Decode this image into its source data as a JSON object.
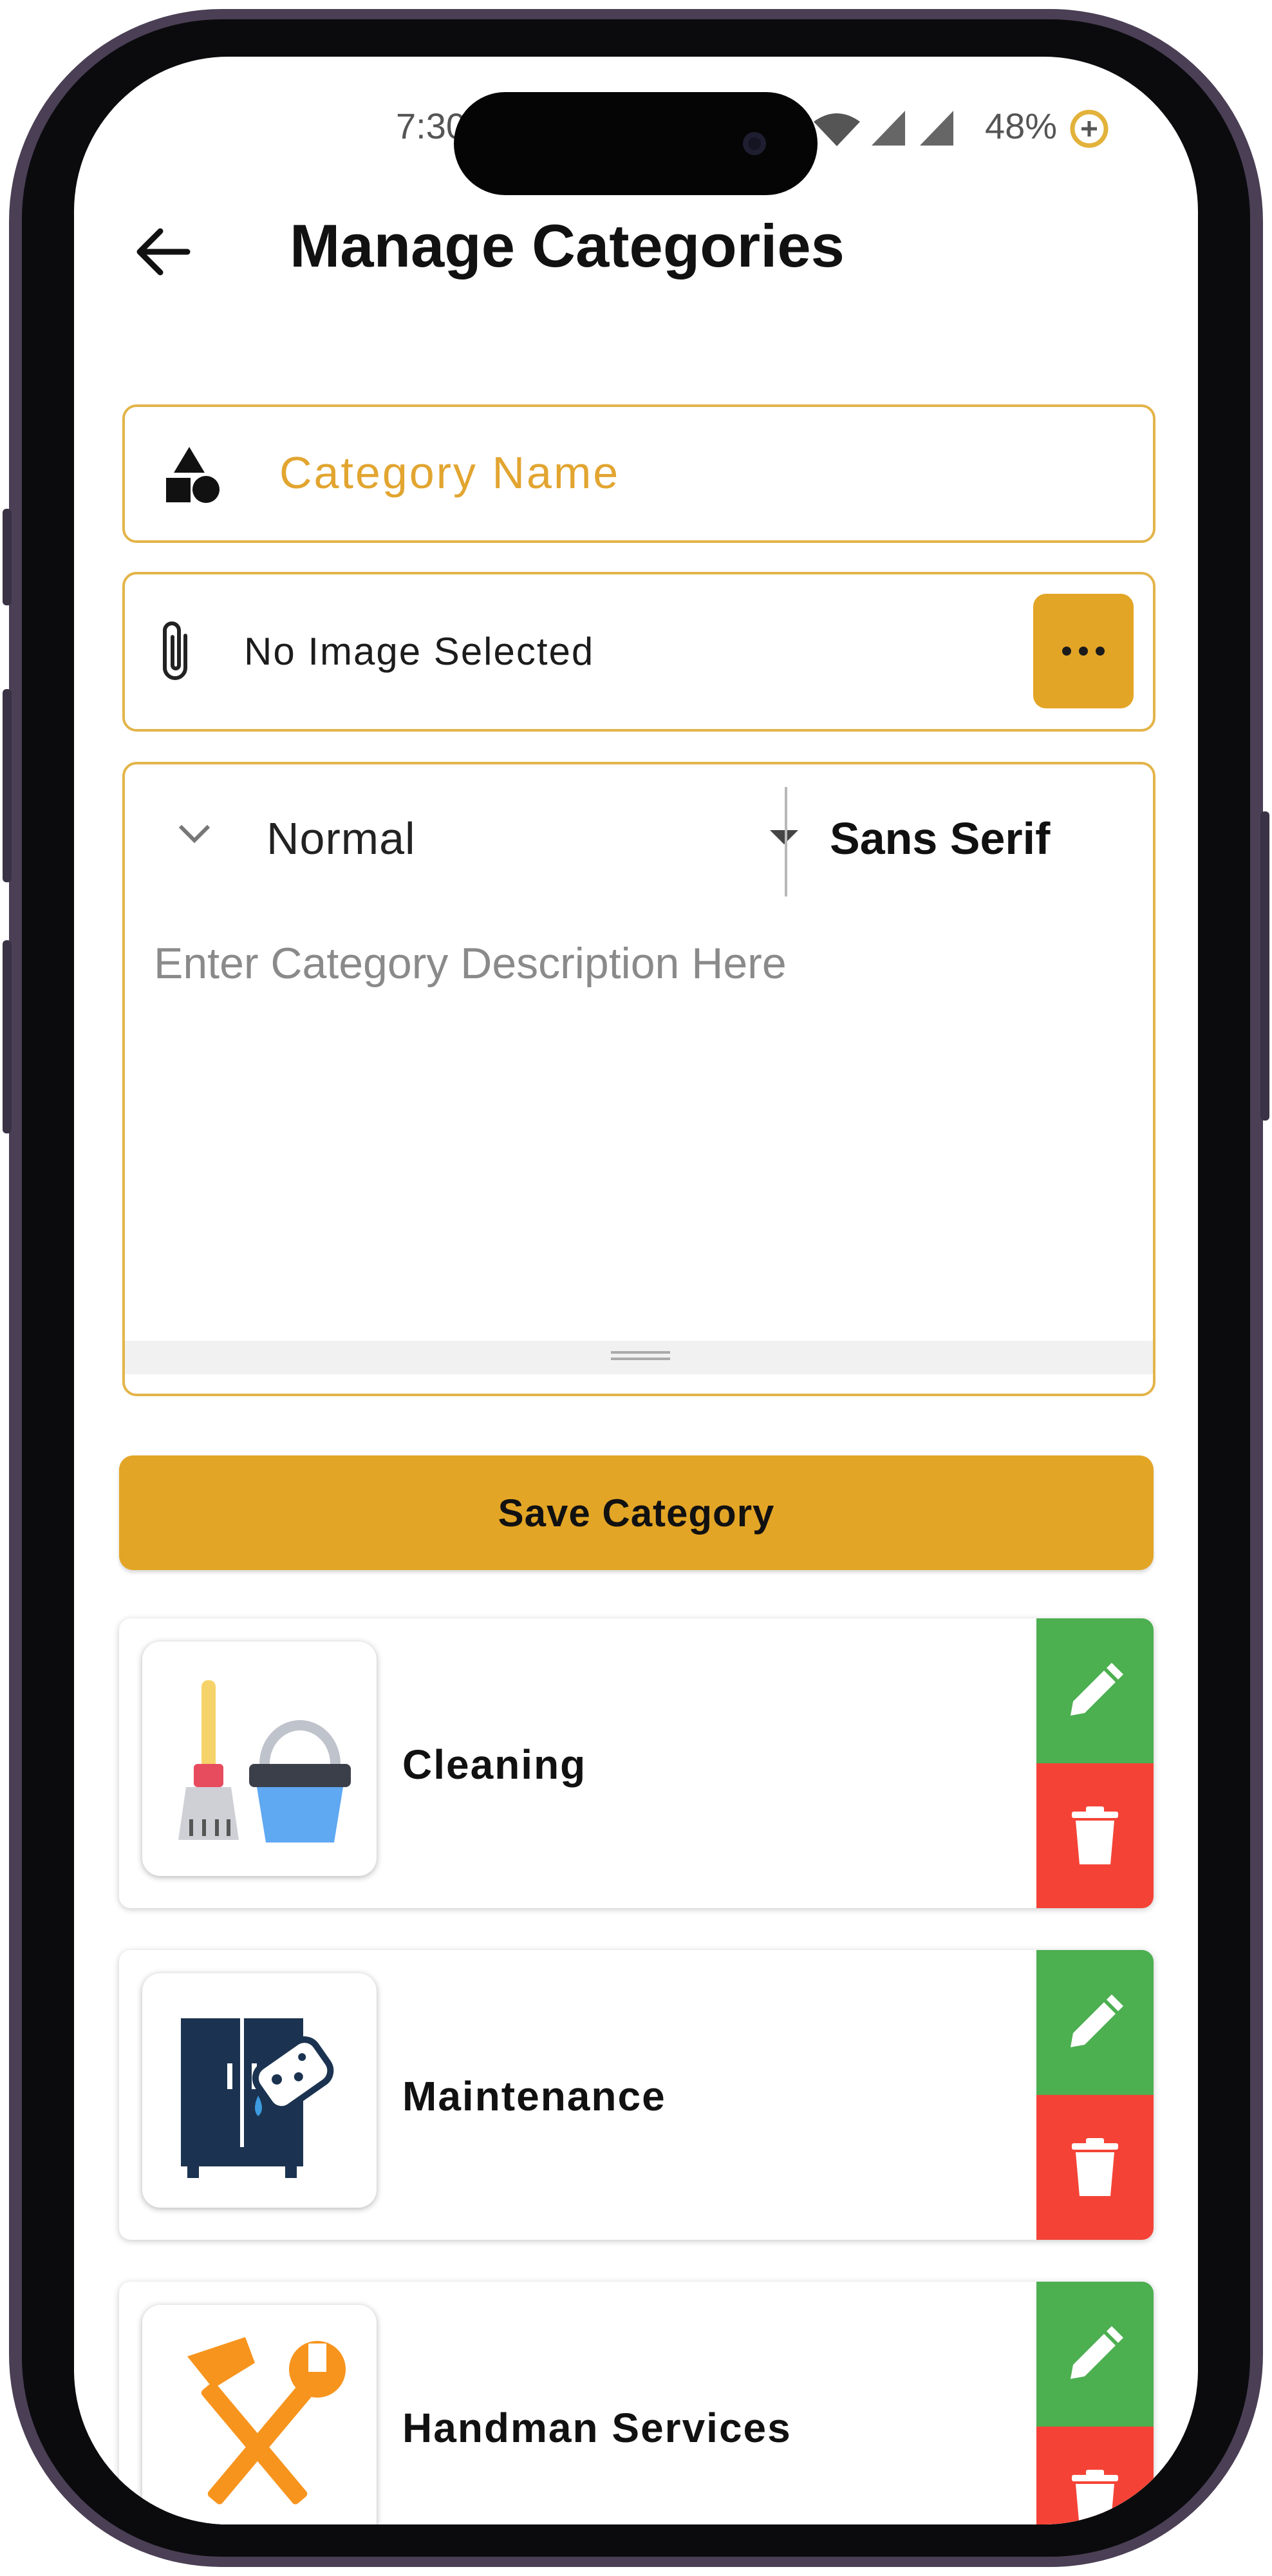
{
  "status_bar": {
    "time": "7:30",
    "battery": "48%"
  },
  "header": {
    "title": "Manage Categories"
  },
  "form": {
    "category_name_placeholder": "Category Name",
    "image_status": "No Image Selected",
    "toolbar": {
      "heading_select": "Normal",
      "font_select": "Sans Serif"
    },
    "description_placeholder": "Enter Category Description Here",
    "save_label": "Save Category"
  },
  "categories": [
    {
      "name": "Cleaning",
      "icon": "broom-bucket-icon"
    },
    {
      "name": "Maintenance",
      "icon": "cabinet-sponge-icon"
    },
    {
      "name": "Handman Services",
      "icon": "hammer-wrench-icon"
    }
  ],
  "colors": {
    "accent": "#e3a526",
    "field_border": "#e3b449",
    "edit": "#4caf50",
    "delete": "#f44336"
  }
}
